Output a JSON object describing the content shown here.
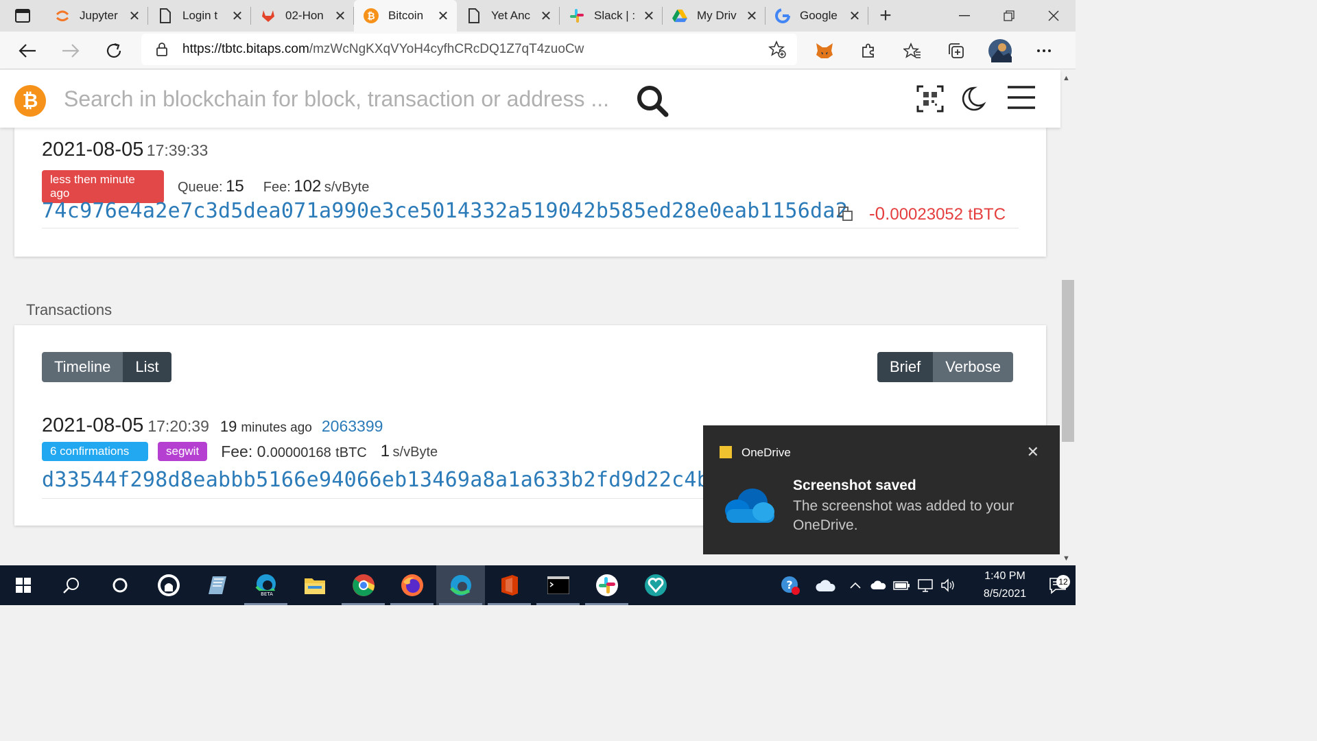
{
  "browser": {
    "tabs": [
      {
        "title": "Jupyter",
        "icon": "jupyter-icon"
      },
      {
        "title": "Login t",
        "icon": "page-icon"
      },
      {
        "title": "02-Hon",
        "icon": "gitlab-icon"
      },
      {
        "title": "Bitcoin",
        "icon": "bitcoin-icon",
        "active": true
      },
      {
        "title": "Yet Anc",
        "icon": "page-icon"
      },
      {
        "title": "Slack | :",
        "icon": "slack-icon"
      },
      {
        "title": "My Driv",
        "icon": "google-drive-icon"
      },
      {
        "title": "Google",
        "icon": "google-icon"
      }
    ],
    "close_glyph": "✕",
    "new_tab_glyph": "+",
    "url_host": "https://tbtc.bitaps.com",
    "url_path": "/mzWcNgKXqVYoH4cyfhCRcDQ1Z7qT4zuoCw"
  },
  "site": {
    "logo_glyph": "₿",
    "search_placeholder": "Search in blockchain for block, transaction or address ..."
  },
  "pending_tx": {
    "date": "2021-08-05",
    "time": "17:39:33",
    "age_badge": "less then minute ago",
    "queue_label": "Queue:",
    "queue_value": "15",
    "fee_label": "Fee:",
    "fee_value": "102",
    "fee_unit": "s/vByte",
    "hash": "74c976e4a2e7c3d5dea071a990e3ce5014332a519042b585ed28e0eab1156da2",
    "amount_sign_int": "-0.",
    "amount_dec": "00023052",
    "amount_unit": "tBTC"
  },
  "transactions": {
    "section_title": "Transactions",
    "view_buttons": [
      "Timeline",
      "List"
    ],
    "detail_buttons": [
      "Brief",
      "Verbose"
    ],
    "item": {
      "date": "2021-08-05",
      "time": "17:20:39",
      "ago_num": "19",
      "ago_text": "minutes ago",
      "block": "2063399",
      "confirmations_badge": "6 confirmations",
      "segwit_badge": "segwit",
      "fee_label": "Fee:",
      "fee_int": "0.",
      "fee_dec": "00000168",
      "fee_unit": "tBTC",
      "rate_value": "1",
      "rate_unit": "s/vByte",
      "hash": "d33544f298d8eabbb5166e94066eb13469a8a1a633b2fd9d22c4b9"
    }
  },
  "toast": {
    "app": "OneDrive",
    "title": "Screenshot saved",
    "body": "The screenshot was added to your OneDrive.",
    "close_glyph": "✕"
  },
  "taskbar": {
    "time": "1:40 PM",
    "date": "8/5/2021",
    "notifications": "12"
  },
  "colors": {
    "accent_orange": "#f6921a",
    "link_blue": "#2b7bb9",
    "negative_red": "#e53e3e",
    "badge_red": "#e34848",
    "badge_blue": "#21a8f0",
    "badge_purple": "#b43fd1"
  }
}
